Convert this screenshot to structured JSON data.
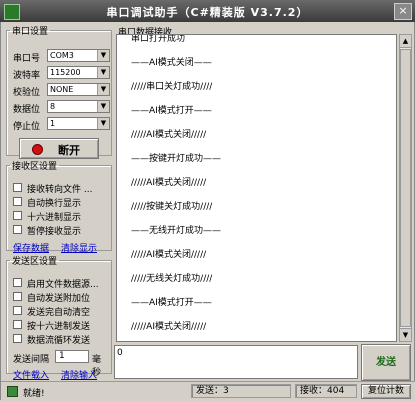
{
  "window": {
    "title": "串口调试助手（C#精装版 V3.7.2）",
    "close_label": "×"
  },
  "serial_settings": {
    "legend": "串口设置",
    "port": {
      "label": "串口号",
      "value": "COM3"
    },
    "baud": {
      "label": "波特率",
      "value": "115200"
    },
    "parity": {
      "label": "校验位",
      "value": "NONE"
    },
    "databits": {
      "label": "数据位",
      "value": "8"
    },
    "stopbits": {
      "label": "停止位",
      "value": "1"
    },
    "open_button": "断开",
    "indicator_color": "#d01010"
  },
  "receive_settings": {
    "legend": "接收区设置",
    "options": [
      "接收转向文件 ...",
      "自动换行显示",
      "十六进制显示",
      "暂停接收显示"
    ],
    "links": [
      "保存数据",
      "清除显示"
    ]
  },
  "send_settings": {
    "legend": "发送区设置",
    "options": [
      "启用文件数据源...",
      "自动发送附加位",
      "发送完自动清空",
      "按十六进制发送",
      "数据流循环发送"
    ],
    "interval_label": "发送间隔",
    "interval_value": "1",
    "interval_unit": "毫秒",
    "links": [
      "文件载入",
      "清除输入"
    ]
  },
  "receive_area": {
    "legend": "串口数据接收",
    "lines": [
      "串口打开成功",
      "——AI模式关闭——",
      "/////串口关灯成功////",
      "——AI模式打开——",
      "/////AI模式关闭/////",
      "——按键开灯成功——",
      "/////AI模式关闭/////",
      "/////按键关灯成功////",
      "——无线开灯成功——",
      "/////AI模式关闭/////",
      "/////无线关灯成功////",
      "——AI模式打开——",
      "/////AI模式关闭/////"
    ]
  },
  "send_area": {
    "value": "0",
    "button": "发送"
  },
  "status_bar": {
    "status": "就绪!",
    "sent": "发送：3",
    "received": "接收：404",
    "reset": "复位计数"
  }
}
